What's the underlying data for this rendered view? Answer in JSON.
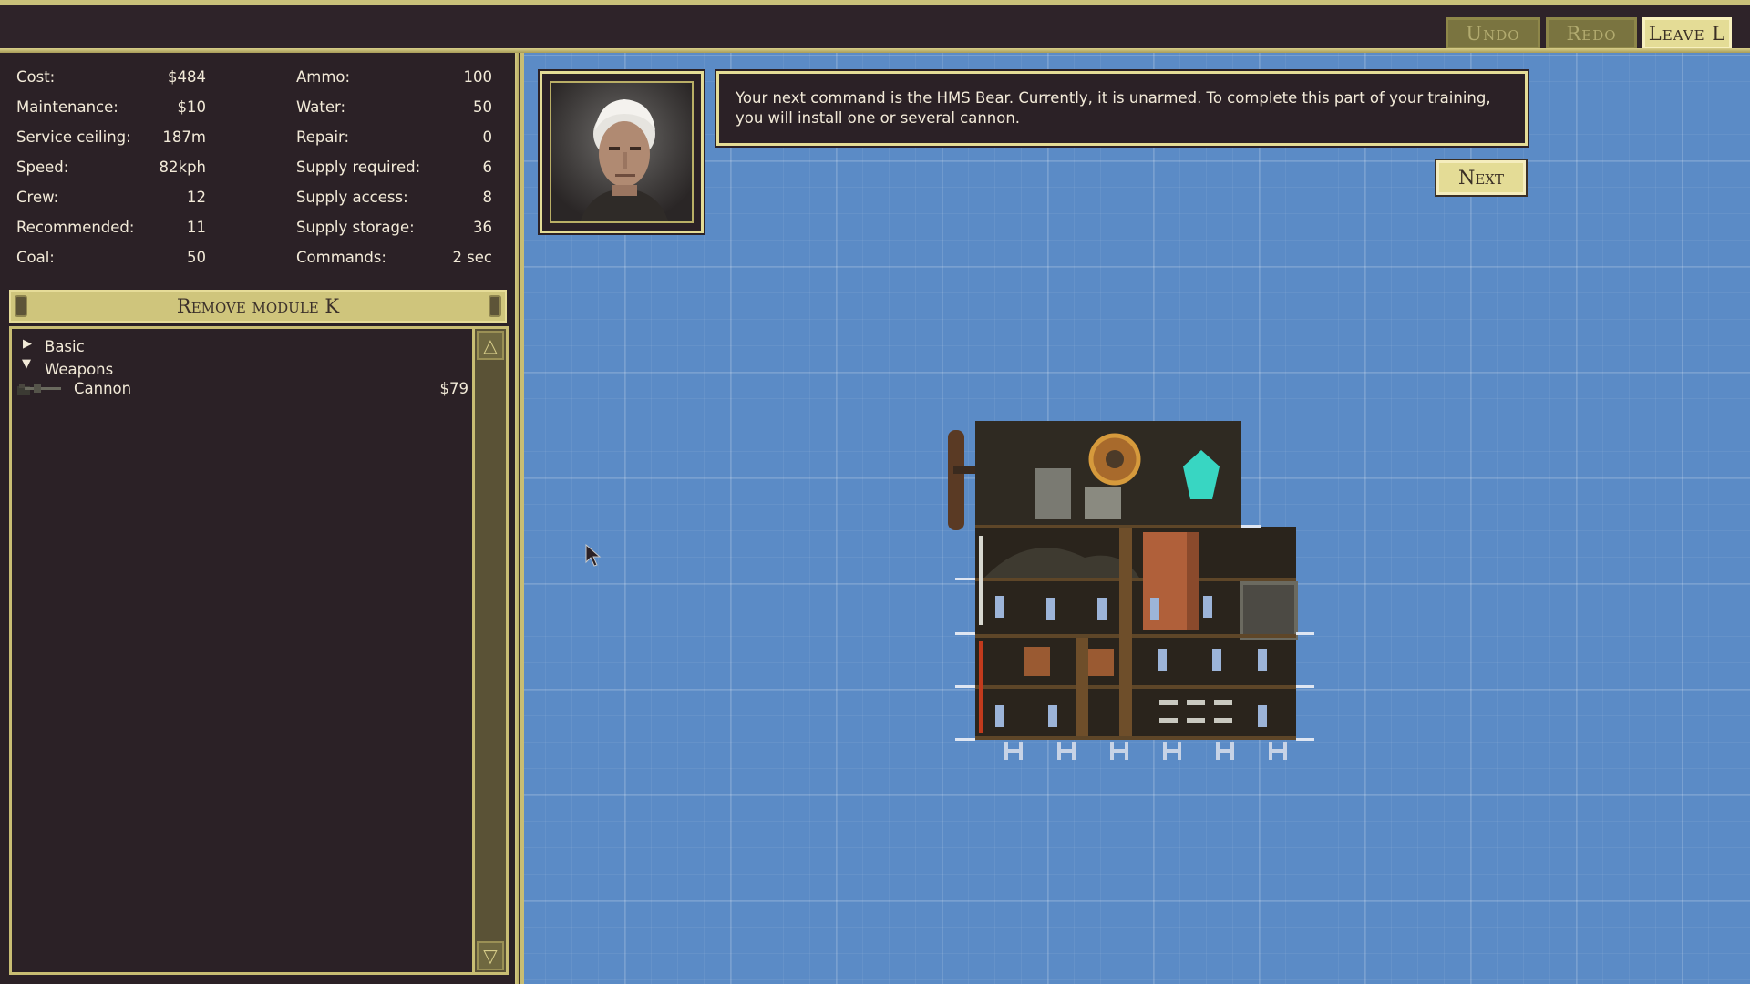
{
  "toolbar": {
    "undo_label": "Undo",
    "redo_label": "Redo",
    "leave_label": "Leave L"
  },
  "stats_left": [
    {
      "label": "Cost:",
      "value": "$484"
    },
    {
      "label": "Maintenance:",
      "value": "$10"
    },
    {
      "label": "Service ceiling:",
      "value": "187m"
    },
    {
      "label": "Speed:",
      "value": "82kph"
    },
    {
      "label": "Crew:",
      "value": "12"
    },
    {
      "label": "Recommended:",
      "value": "11"
    },
    {
      "label": "Coal:",
      "value": "50"
    }
  ],
  "stats_right": [
    {
      "label": "Ammo:",
      "value": "100"
    },
    {
      "label": "Water:",
      "value": "50"
    },
    {
      "label": "Repair:",
      "value": "0"
    },
    {
      "label": "Supply required:",
      "value": "6"
    },
    {
      "label": "Supply access:",
      "value": "8"
    },
    {
      "label": "Supply storage:",
      "value": "36"
    },
    {
      "label": "Commands:",
      "value": "2 sec"
    }
  ],
  "remove_module_label": "Remove module K",
  "module_tree": {
    "categories": [
      {
        "label": "Basic",
        "expanded": false
      },
      {
        "label": "Weapons",
        "expanded": true
      }
    ],
    "items": [
      {
        "name": "Cannon",
        "price": "$79",
        "icon": "cannon-icon"
      }
    ]
  },
  "dialog": {
    "text": "Your next command is the HMS Bear. Currently, it is unarmed. To complete this part of your training, you will install one or several cannon.",
    "next_label": "Next"
  },
  "colors": {
    "panel_bg": "#2b2126",
    "gold": "#e4dc96",
    "blueprint": "#5b8bc6"
  }
}
